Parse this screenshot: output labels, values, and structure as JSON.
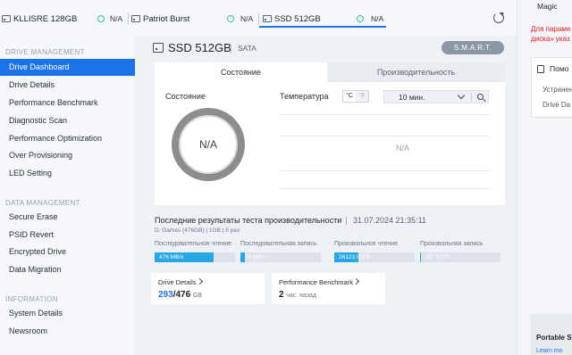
{
  "drive_tabs": [
    {
      "name": "KLLISRE 128GB",
      "status": "N/A"
    },
    {
      "name": "Patriot Burst",
      "status": "N/A"
    },
    {
      "name": "SSD 512GB",
      "status": "N/A"
    }
  ],
  "sidebar": {
    "sections": [
      {
        "label": "DRIVE MANAGEMENT",
        "items": [
          "Drive Dashboard",
          "Drive Details",
          "Performance Benchmark",
          "Diagnostic Scan",
          "Performance Optimization",
          "Over Provisioning",
          "LED Setting"
        ]
      },
      {
        "label": "DATA MANAGEMENT",
        "items": [
          "Secure Erase",
          "PSID Revert",
          "Encrypted Drive",
          "Data Migration"
        ]
      },
      {
        "label": "INFORMATION",
        "items": [
          "System Details",
          "Newsroom"
        ]
      }
    ],
    "active_item": "Drive Dashboard"
  },
  "drive": {
    "title": "SSD 512GB",
    "interface": "SATA",
    "smart_button": "S.M.A.R.T."
  },
  "status_panel": {
    "tabs": [
      "Состояние",
      "Производительность"
    ],
    "state_label": "Состояние",
    "state_value": "N/A",
    "temperature_label": "Температура",
    "unit_c": "°C",
    "unit_f": "°F",
    "time_range": "10 мин.",
    "temperature_value": "N/A"
  },
  "benchmark": {
    "title": "Последние результаты теста производительности",
    "date": "31.07.2024 21:35:11",
    "meta": "D: Games (476GB)  |  1GB  |  5 раз",
    "metrics": [
      {
        "label": "Последовательное чтение",
        "value": "476 MB/c",
        "fill_percent": 73
      },
      {
        "label": "Последовательная запись",
        "value": "76 MB/c",
        "fill_percent": 5
      },
      {
        "label": "Произвольное чтение",
        "value": "26123 IOPS",
        "fill_percent": 30
      },
      {
        "label": "Произвольная запись",
        "value": "122 IOPS",
        "fill_percent": 1
      }
    ]
  },
  "cards": {
    "drive_details": {
      "title": "Drive Details",
      "used": "293",
      "total": "/476",
      "unit": "GB"
    },
    "performance_benchmark": {
      "title": "Performance Benchmark",
      "value": "2",
      "unit": "час. назад"
    }
  },
  "right_panel": {
    "title": "Magic",
    "warning_line1": "Для параме",
    "warning_line2": "диска» указ",
    "help_title": "Помо",
    "help_item1": "Устранен",
    "help_item2": "Drive Da",
    "product_title": "Portable S",
    "product_link": "Learn mo"
  },
  "colors": {
    "accent": "#1a73e8",
    "bar_fill": "#29a6e6",
    "status_ring": "#3ec0a0",
    "warning": "#e02020"
  }
}
